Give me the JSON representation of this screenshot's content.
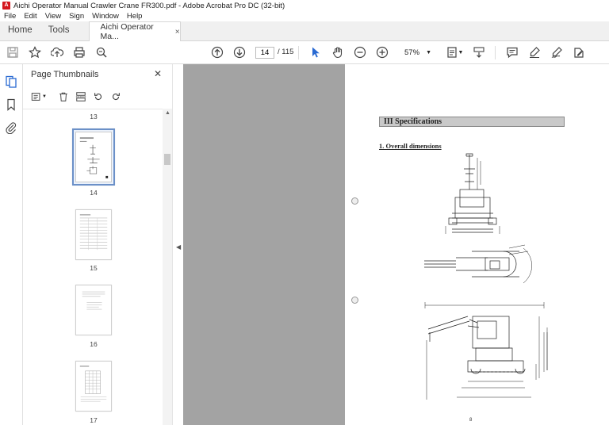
{
  "window": {
    "title": "Aichi Operator Manual Crawler Crane FR300.pdf - Adobe Acrobat Pro DC (32-bit)"
  },
  "menu": [
    "File",
    "Edit",
    "View",
    "Sign",
    "Window",
    "Help"
  ],
  "tabs": {
    "home": "Home",
    "tools": "Tools",
    "document": "Aichi Operator Ma...",
    "close": "×"
  },
  "toolbar": {
    "page_current": "14",
    "page_total": "/ 115",
    "zoom": "57%",
    "icons": [
      "save-icon",
      "bookmark-star-icon",
      "upload-icon",
      "print-icon",
      "search-zoom-icon",
      "prev-page-icon",
      "next-page-icon",
      "select-cursor-icon",
      "hand-tool-icon",
      "zoom-out-icon",
      "zoom-in-icon",
      "fit-page-icon",
      "scroll-mode-icon",
      "comment-icon",
      "highlight-icon",
      "sign-icon",
      "share-edit-icon"
    ]
  },
  "panel": {
    "title": "Page Thumbnails",
    "close": "✕",
    "thumbnails": [
      {
        "label": "13"
      },
      {
        "label": "14",
        "selected": true
      },
      {
        "label": "15"
      },
      {
        "label": "16"
      },
      {
        "label": "17"
      }
    ]
  },
  "document_page": {
    "section_title": "III   Specifications",
    "subsection_title": "1.   Overall dimensions",
    "page_number": "8"
  },
  "colors": {
    "accent_pdf": "#d4151c",
    "viewer_bg": "#a3a3a3",
    "selected_thumb": "#6b90c8",
    "cursor_blue": "#2a6ad2"
  }
}
